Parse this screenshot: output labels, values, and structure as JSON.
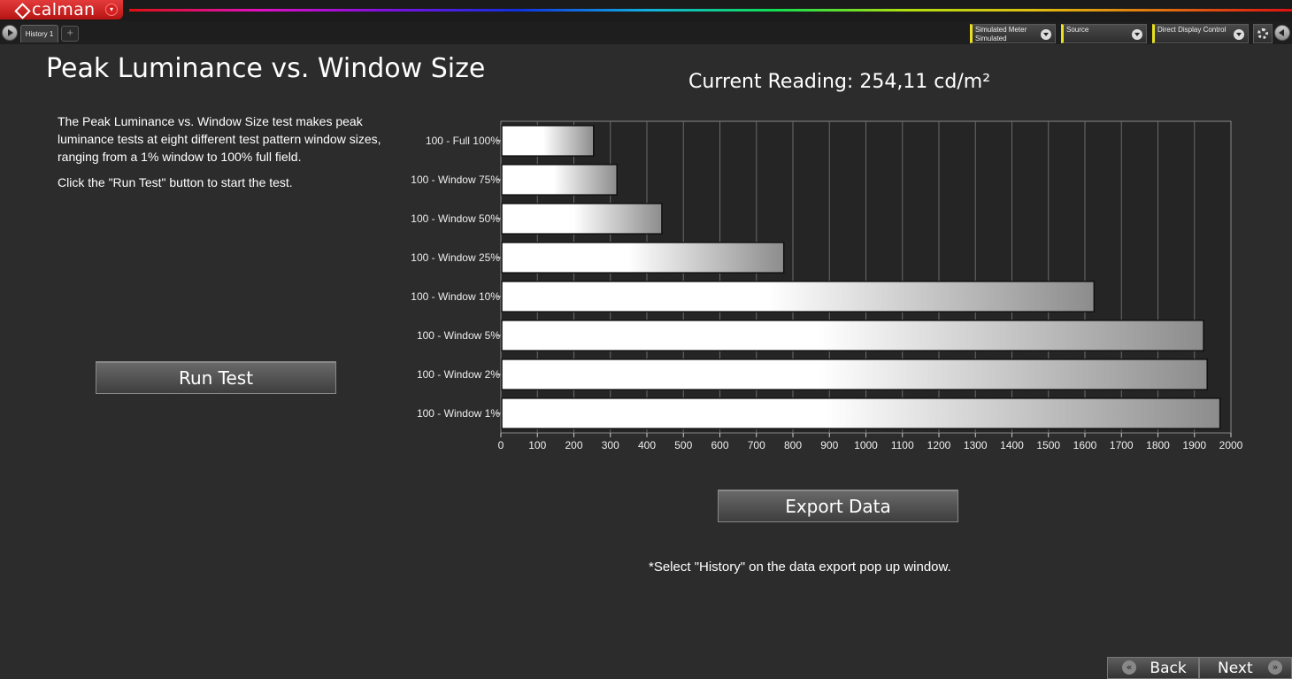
{
  "app": {
    "logo_text": "calman",
    "tab_label": "History 1"
  },
  "toolbar": {
    "meter_line1": "Simulated Meter",
    "meter_line2": "Simulated",
    "source_label": "Source",
    "display_control_label": "Direct Display Control"
  },
  "page": {
    "title": "Peak Luminance vs. Window Size",
    "description": "The Peak Luminance vs. Window Size test makes peak luminance tests at eight different test pattern window sizes, ranging from a 1% window to 100% full field.",
    "instruction": "Click the \"Run Test\" button to start the test.",
    "run_button": "Run Test",
    "current_reading": "Current Reading: 254,11 cd/m²",
    "export_button": "Export  Data",
    "export_note": "*Select \"History\" on the data export pop up window."
  },
  "nav": {
    "back_label": "Back",
    "next_label": "Next"
  },
  "chart_data": {
    "type": "bar",
    "orientation": "horizontal",
    "categories": [
      "100 - Full  100%",
      "100 - Window 75%",
      "100 - Window 50%",
      "100 - Window 25%",
      "100 - Window 10%",
      "100 - Window  5%",
      "100 - Window  2%",
      "100 - Window  1%"
    ],
    "values": [
      254,
      318,
      441,
      775,
      1625,
      1925,
      1935,
      1970
    ],
    "xlim": [
      0,
      2000
    ],
    "xticks": [
      0,
      100,
      200,
      300,
      400,
      500,
      600,
      700,
      800,
      900,
      1000,
      1100,
      1200,
      1300,
      1400,
      1500,
      1600,
      1700,
      1800,
      1900,
      2000
    ],
    "grid": true,
    "colors": {
      "background": "#252525",
      "grid": "#6a6a6a",
      "bar_light": "#ffffff",
      "bar_dark": "#8c8c8c"
    }
  }
}
